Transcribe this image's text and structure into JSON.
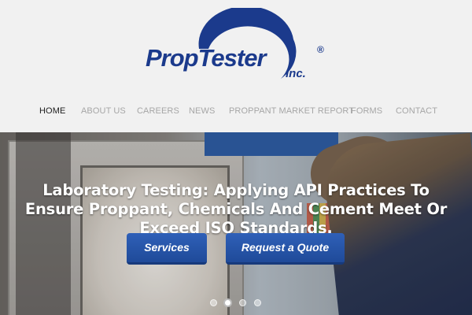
{
  "brand": {
    "name": "PropTester",
    "registered": "®",
    "suffix": "Inc.",
    "color": "#1b3a8c"
  },
  "nav": {
    "items": [
      {
        "label": "HOME",
        "active": true
      },
      {
        "label": "ABOUT US",
        "active": false
      },
      {
        "label": "CAREERS",
        "active": false
      },
      {
        "label": "NEWS",
        "active": false
      },
      {
        "label": "PROPPANT MARKET REPORT",
        "active": false
      },
      {
        "label": "FORMS",
        "active": false
      },
      {
        "label": "CONTACT",
        "active": false
      }
    ]
  },
  "hero": {
    "title": "Laboratory Testing: Applying API Practices To Ensure Proppant, Chemicals And Cement Meet Or Exceed ISO Standards.",
    "buttons": {
      "services": "Services",
      "quote": "Request a Quote"
    },
    "slides": {
      "count": 4,
      "active_index": 1
    }
  },
  "colors": {
    "button": "#1f4a99",
    "nav_active": "#1e1e1e",
    "nav_inactive": "#a6a6a6"
  }
}
